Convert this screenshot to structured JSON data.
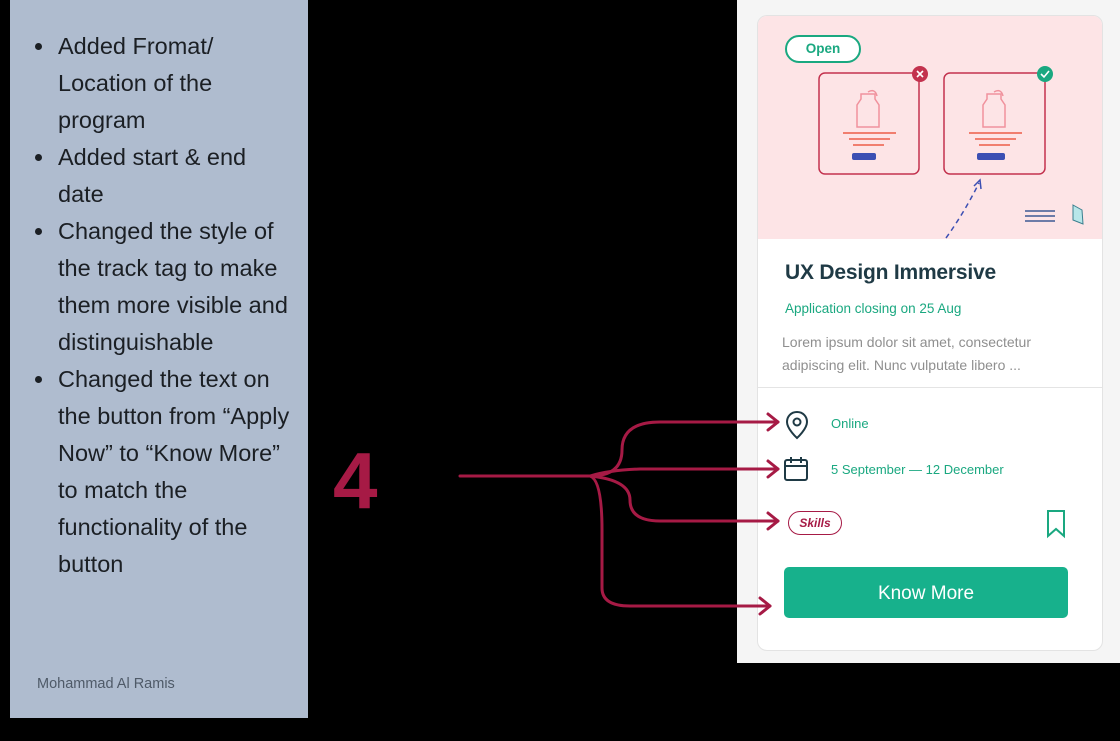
{
  "notes": {
    "items": [
      "Added Fromat/ Location of the program",
      "Added start & end date",
      "Changed the style of the track tag to make them more visible and distinguishable",
      "Changed the text on the button from “Apply Now” to “Know More” to match the functionality of the button"
    ],
    "author": "Mohammad Al Ramis"
  },
  "step_number": "4",
  "card": {
    "status_badge": "Open",
    "title": "UX Design Immersive",
    "deadline": "Application closing on 25 Aug",
    "description": "Lorem ipsum dolor sit amet, consectetur adipiscing elit. Nunc vulputate libero ...",
    "location": "Online",
    "dates": "5 September — 12 December",
    "track_tag": "Skills",
    "cta_label": "Know More",
    "location_icon": "map-pin-icon",
    "date_icon": "calendar-icon",
    "save_icon": "bookmark-icon"
  },
  "colors": {
    "accent": "#1aa880",
    "button": "#17b18c",
    "annotation": "#a61a45",
    "note_panel": "#afbccf",
    "hero_bg": "#fde4e6"
  }
}
